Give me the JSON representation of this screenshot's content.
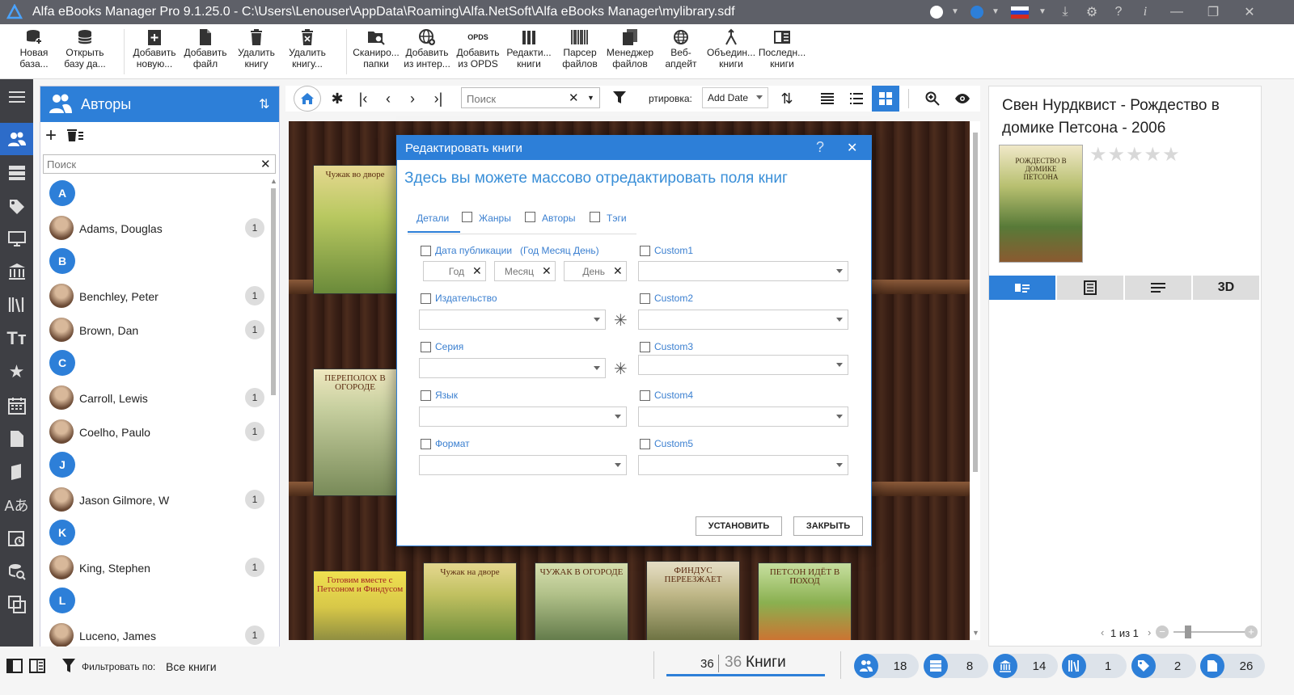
{
  "titlebar": {
    "title": "Alfa eBooks Manager Pro 9.1.25.0 - C:\\Users\\Lenouser\\AppData\\Roaming\\Alfa.NetSoft\\Alfa eBooks Manager\\mylibrary.sdf"
  },
  "ribbon": {
    "items": [
      {
        "l1": "Новая",
        "l2": "база..."
      },
      {
        "l1": "Открыть",
        "l2": "базу да..."
      },
      {
        "l1": "Добавить",
        "l2": "новую..."
      },
      {
        "l1": "Добавить",
        "l2": "файл"
      },
      {
        "l1": "Удалить",
        "l2": "книгу"
      },
      {
        "l1": "Удалить",
        "l2": "книгу..."
      },
      {
        "l1": "Сканиро...",
        "l2": "папки"
      },
      {
        "l1": "Добавить",
        "l2": "из интер..."
      },
      {
        "l1": "Добавить",
        "l2": "из OPDS"
      },
      {
        "l1": "Редакти...",
        "l2": "книги"
      },
      {
        "l1": "Парсер",
        "l2": "файлов"
      },
      {
        "l1": "Менеджер",
        "l2": "файлов"
      },
      {
        "l1": "Веб-",
        "l2": "апдейт"
      },
      {
        "l1": "Объедин...",
        "l2": "книги"
      },
      {
        "l1": "Последн...",
        "l2": "книги"
      }
    ],
    "opds_glyph": "OPDS"
  },
  "authors": {
    "title": "Авторы",
    "search_placeholder": "Поиск",
    "list": [
      {
        "type": "letter",
        "text": "A"
      },
      {
        "type": "author",
        "name": "Adams, Douglas",
        "count": "1"
      },
      {
        "type": "letter",
        "text": "B"
      },
      {
        "type": "author",
        "name": "Benchley, Peter",
        "count": "1"
      },
      {
        "type": "author",
        "name": "Brown, Dan",
        "count": "1"
      },
      {
        "type": "letter",
        "text": "C"
      },
      {
        "type": "author",
        "name": "Carroll, Lewis",
        "count": "1"
      },
      {
        "type": "author",
        "name": "Coelho, Paulo",
        "count": "1"
      },
      {
        "type": "letter",
        "text": "J"
      },
      {
        "type": "author",
        "name": "Jason Gilmore, W",
        "count": "1"
      },
      {
        "type": "letter",
        "text": "K"
      },
      {
        "type": "author",
        "name": "King, Stephen",
        "count": "1"
      },
      {
        "type": "letter",
        "text": "L"
      },
      {
        "type": "author",
        "name": "Luceno, James",
        "count": "1"
      }
    ]
  },
  "center_toolbar": {
    "search_placeholder": "Поиск",
    "sort_label": "ртировка:",
    "sort_value": "Add Date"
  },
  "shelf": {
    "books": [
      {
        "title": "Чужак во дворе"
      },
      {
        "title": "ПЕРЕПОЛОХ В ОГОРОДЕ"
      },
      {
        "title": "Готовим вместе с Петсоном и Финдусом"
      },
      {
        "title": "Чужак на дворе"
      },
      {
        "title": "ЧУЖАК В ОГОРОДЕ"
      },
      {
        "title": "ФИНДУС ПЕРЕЕЗЖАЕТ"
      },
      {
        "title": "ПЕТСОН ИДЁТ В ПОХОД"
      }
    ]
  },
  "dialog": {
    "title": "Редактировать книги",
    "heading": "Здесь вы можете массово отредактировать поля книг",
    "tabs": [
      "Детали",
      "Жанры",
      "Авторы",
      "Тэги"
    ],
    "pubdate_label": "Дата публикации",
    "pubdate_hint": "(Год Месяц День)",
    "year_placeholder": "Год",
    "month_placeholder": "Месяц",
    "day_placeholder": "День",
    "publisher_label": "Издательство",
    "series_label": "Серия",
    "language_label": "Язык",
    "format_label": "Формат",
    "custom": [
      "Custom1",
      "Custom2",
      "Custom3",
      "Custom4",
      "Custom5"
    ],
    "apply_button": "УСТАНОВИТЬ",
    "close_button": "ЗАКРЫТЬ"
  },
  "details": {
    "title": "Свен Нурдквист - Рождество в домике Петсона - 2006",
    "cover_text": "РОЖДЕСТВО В ДОМИКЕ ПЕТСОНА",
    "rating": 0,
    "view_3d": "3D",
    "page_indicator": "1 из 1"
  },
  "status": {
    "filter_label": "Фильтровать по:",
    "filter_value": "Все книги",
    "shown": "36",
    "total": "36",
    "books_label": "Книги",
    "badges": [
      {
        "icon": "authors-icon",
        "value": "18"
      },
      {
        "icon": "series-icon",
        "value": "8"
      },
      {
        "icon": "publisher-icon",
        "value": "14"
      },
      {
        "icon": "library-icon",
        "value": "1"
      },
      {
        "icon": "tag-icon",
        "value": "2"
      },
      {
        "icon": "file-icon",
        "value": "26"
      }
    ]
  },
  "colors": {
    "accent": "#2d7fd8",
    "titlebar": "#5e6068",
    "sidebar": "#3e3f44"
  }
}
